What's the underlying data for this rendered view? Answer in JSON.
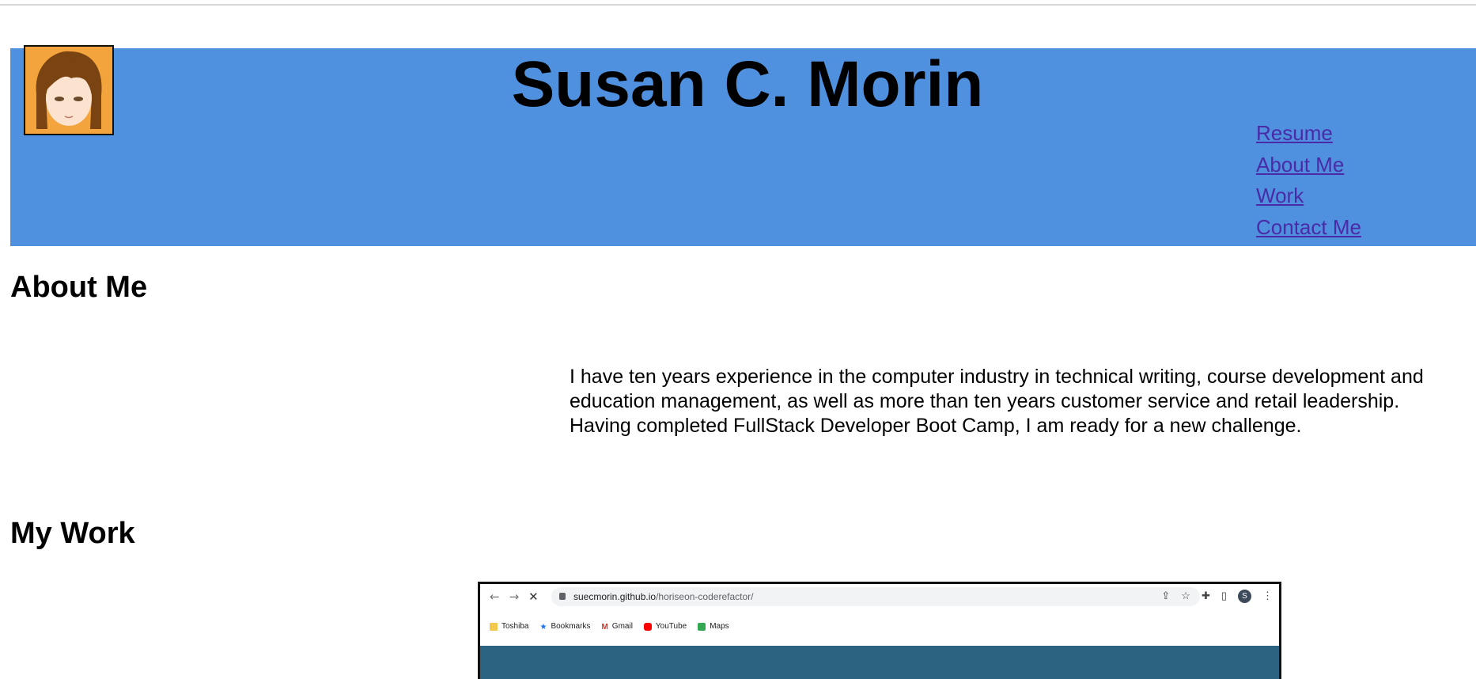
{
  "header": {
    "name": "Susan C. Morin",
    "nav": [
      {
        "label": "Resume"
      },
      {
        "label": "About Me"
      },
      {
        "label": "Work"
      },
      {
        "label": "Contact Me"
      }
    ]
  },
  "about": {
    "heading": "About Me",
    "text": "I have ten years experience in the computer industry in technical writing, course development and education management, as well as more than ten years customer service and retail leadership. Having completed FullStack Developer Boot Camp, I am ready for a new challenge."
  },
  "work": {
    "heading": "My Work",
    "screenshot": {
      "url_host": "suecmorin.github.io",
      "url_path": "/horiseon-coderefactor/",
      "profile_initial": "S",
      "bookmarks": [
        "Toshiba",
        "Bookmarks",
        "Gmail",
        "YouTube",
        "Maps"
      ]
    }
  },
  "colors": {
    "header_bg": "#4f91df",
    "link": "#4b2aa8",
    "avatar_bg": "#f4a43c",
    "thumbnail_page_bg": "#2b6380"
  }
}
